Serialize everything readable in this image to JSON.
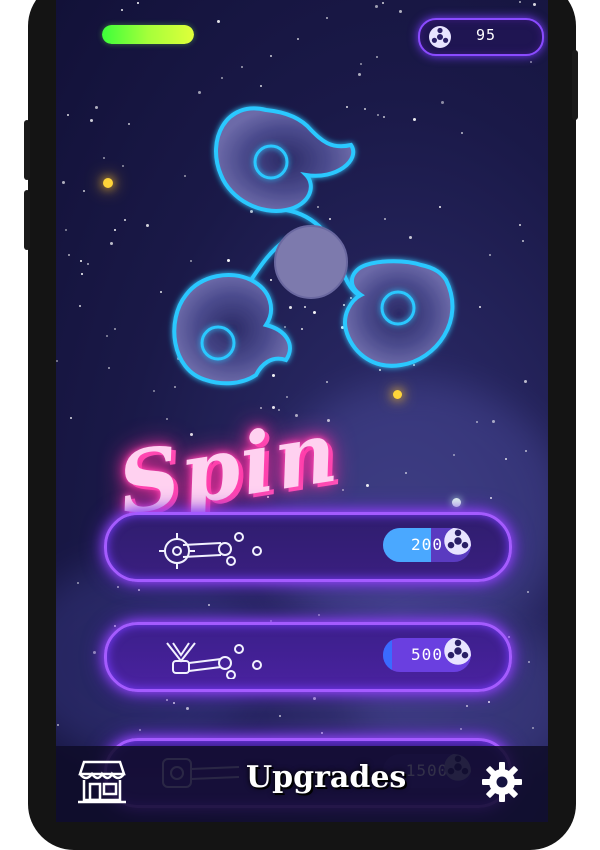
{
  "hud": {
    "energy_fraction": 1.0,
    "coins": "95",
    "energy_color": "#4cff3a"
  },
  "center": {
    "title": "Spin"
  },
  "upgrades": [
    {
      "cost": "200",
      "icon": "pedal-gear-chain-icon",
      "fill_fraction": 0.55,
      "fill_color": "#4aa8ff"
    },
    {
      "cost": "500",
      "icon": "engine-chain-icon",
      "fill_fraction": 0.1,
      "fill_color": "#3a6bff"
    },
    {
      "cost": "1500",
      "icon": "motor-chain-icon",
      "fill_fraction": 0.0,
      "fill_color": "#5a3bc0"
    }
  ],
  "bottom_bar": {
    "title": "Upgrades",
    "shop_icon": "shop-icon",
    "settings_icon": "gear-icon"
  },
  "colors": {
    "neon_blue": "#2ac8ff",
    "neon_purple": "#a45bff",
    "neon_pink": "#ff2fa0",
    "background": "#1a1948"
  }
}
